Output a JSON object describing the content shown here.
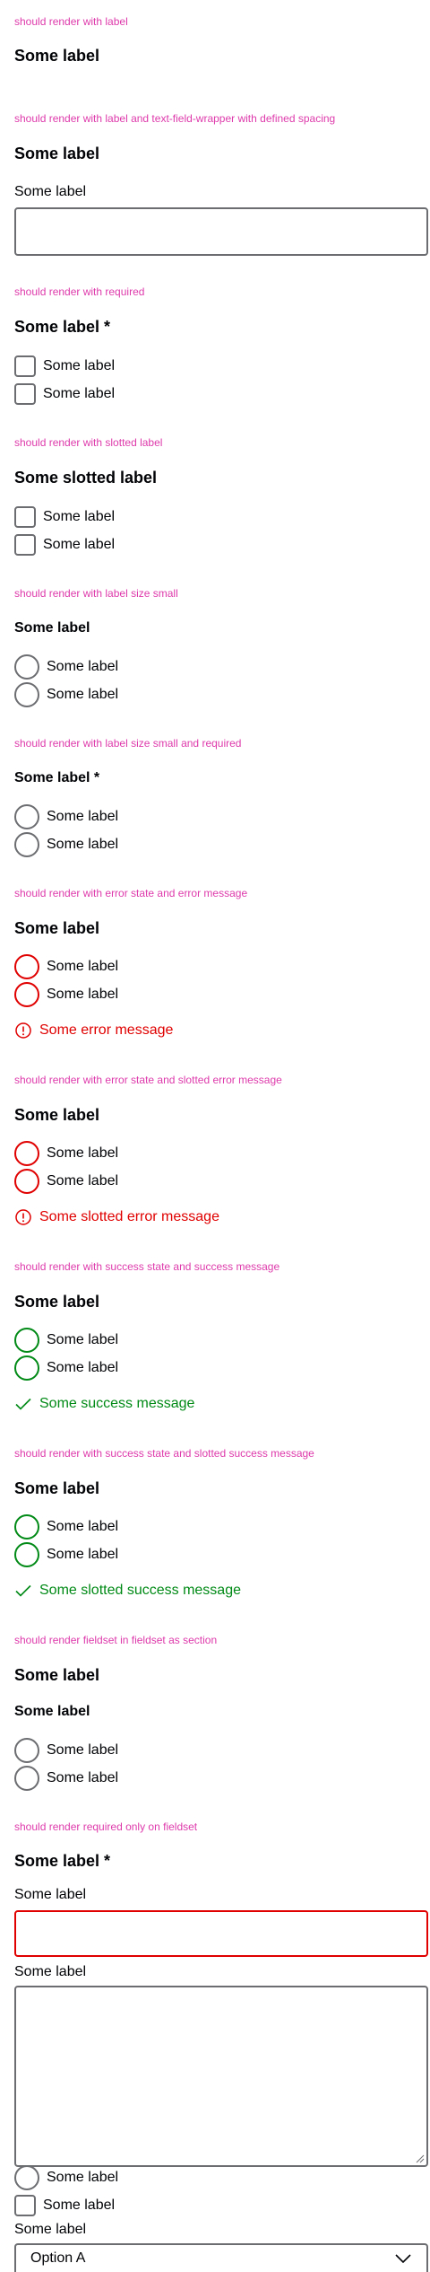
{
  "sections": [
    {
      "caption": "should render with label",
      "legend": "Some label"
    },
    {
      "caption": "should render with label and text-field-wrapper with defined spacing",
      "legend": "Some label",
      "field_label": "Some label"
    },
    {
      "caption": "should render with required",
      "legend": "Some label *",
      "options": [
        "Some label",
        "Some label"
      ]
    },
    {
      "caption": "should render with slotted label",
      "legend": "Some slotted label",
      "options": [
        "Some label",
        "Some label"
      ]
    },
    {
      "caption": "should render with label size small",
      "legend": "Some label",
      "options": [
        "Some label",
        "Some label"
      ]
    },
    {
      "caption": "should render with label size small and required",
      "legend": "Some label *",
      "options": [
        "Some label",
        "Some label"
      ]
    },
    {
      "caption": "should render with error state and error message",
      "legend": "Some label",
      "options": [
        "Some label",
        "Some label"
      ],
      "message": "Some error message"
    },
    {
      "caption": "should render with error state and slotted error message",
      "legend": "Some label",
      "options": [
        "Some label",
        "Some label"
      ],
      "message": "Some slotted error message"
    },
    {
      "caption": "should render with success state and success message",
      "legend": "Some label",
      "options": [
        "Some label",
        "Some label"
      ],
      "message": "Some success message"
    },
    {
      "caption": "should render with success state and slotted success message",
      "legend": "Some label",
      "options": [
        "Some label",
        "Some label"
      ],
      "message": "Some slotted success message"
    },
    {
      "caption": "should render fieldset in fieldset as section",
      "legend": "Some label",
      "sub_legend": "Some label",
      "options": [
        "Some label",
        "Some label"
      ]
    },
    {
      "caption": "should render required only on fieldset",
      "legend": "Some label *",
      "input_label": "Some label",
      "textarea_label": "Some label",
      "radio_label": "Some label",
      "checkbox_label": "Some label",
      "select_label": "Some label",
      "select_value": "Option A"
    }
  ],
  "icons": {
    "error": "exclamation-circle-icon",
    "success": "check-icon",
    "select": "chevron-down-icon"
  },
  "colors": {
    "caption": "#de3aab",
    "error": "#e00000",
    "success": "#018a16",
    "border": "#6b6d70",
    "text": "#010205"
  }
}
